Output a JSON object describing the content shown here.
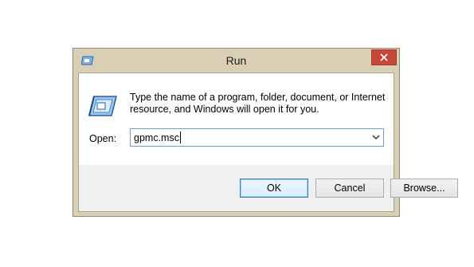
{
  "window": {
    "title": "Run",
    "close_label": "Close"
  },
  "content": {
    "description_line1": "Type the name of a program, folder, document, or Internet",
    "description_line2": "resource, and Windows will open it for you.",
    "open_label": "Open:",
    "open_value": "gpmc.msc"
  },
  "buttons": {
    "ok": "OK",
    "cancel": "Cancel",
    "browse": "Browse..."
  },
  "colors": {
    "frame": "#d9cfb4",
    "close_button": "#c7473b",
    "input_border": "#6e9fd1",
    "default_button_border": "#3c7fb1"
  },
  "icons": {
    "title_icon": "run-app-icon",
    "dialog_icon": "run-app-icon",
    "close_icon": "close-x-icon",
    "dropdown_icon": "chevron-down-icon"
  }
}
